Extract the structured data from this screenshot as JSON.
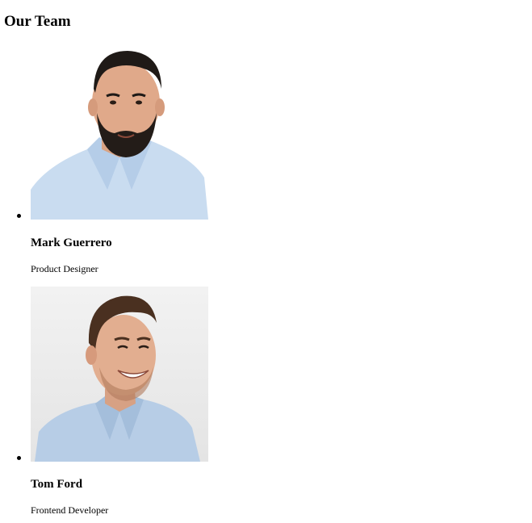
{
  "page": {
    "title": "Our Team"
  },
  "team": [
    {
      "name": "Mark Guerrero",
      "role": "Product Designer",
      "photo": "portrait-man-beard"
    },
    {
      "name": "Tom Ford",
      "role": "Frontend Developer",
      "photo": "portrait-man-smiling"
    }
  ]
}
